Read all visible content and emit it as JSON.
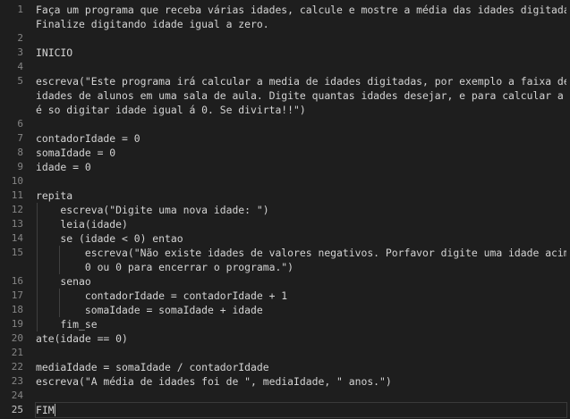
{
  "editor": {
    "lines": [
      {
        "num": "1",
        "text": "Faça um programa que receba várias idades, calcule e mostre a média das idades digitadas."
      },
      {
        "num": "",
        "text": "Finalize digitando idade igual a zero."
      },
      {
        "num": "2",
        "text": ""
      },
      {
        "num": "3",
        "text": "INICIO"
      },
      {
        "num": "4",
        "text": ""
      },
      {
        "num": "5",
        "text": "escreva(\"Este programa irá calcular a media de idades digitadas, por exemplo a faixa de"
      },
      {
        "num": "",
        "text": "idades de alunos em uma sala de aula. Digite quantas idades desejar, e para calcular a media"
      },
      {
        "num": "",
        "text": "é so digitar idade igual á 0. Se divirta!!\")"
      },
      {
        "num": "6",
        "text": ""
      },
      {
        "num": "7",
        "text": "contadorIdade = 0"
      },
      {
        "num": "8",
        "text": "somaIdade = 0"
      },
      {
        "num": "9",
        "text": "idade = 0"
      },
      {
        "num": "10",
        "text": ""
      },
      {
        "num": "11",
        "text": "repita"
      },
      {
        "num": "12",
        "text": "    escreva(\"Digite uma nova idade: \")"
      },
      {
        "num": "13",
        "text": "    leia(idade)"
      },
      {
        "num": "14",
        "text": "    se (idade < 0) entao"
      },
      {
        "num": "15",
        "text": "        escreva(\"Não existe idades de valores negativos. Porfavor digite uma idade acima de"
      },
      {
        "num": "",
        "text": "        0 ou 0 para encerrar o programa.\")"
      },
      {
        "num": "16",
        "text": "    senao"
      },
      {
        "num": "17",
        "text": "        contadorIdade = contadorIdade + 1"
      },
      {
        "num": "18",
        "text": "        somaIdade = somaIdade + idade"
      },
      {
        "num": "19",
        "text": "    fim_se"
      },
      {
        "num": "20",
        "text": "ate(idade == 0)"
      },
      {
        "num": "21",
        "text": ""
      },
      {
        "num": "22",
        "text": "mediaIdade = somaIdade / contadorIdade"
      },
      {
        "num": "23",
        "text": "escreva(\"A média de idades foi de \", mediaIdade, \" anos.\")"
      },
      {
        "num": "24",
        "text": ""
      },
      {
        "num": "25",
        "text": "FIM"
      }
    ],
    "active_line": "25"
  }
}
